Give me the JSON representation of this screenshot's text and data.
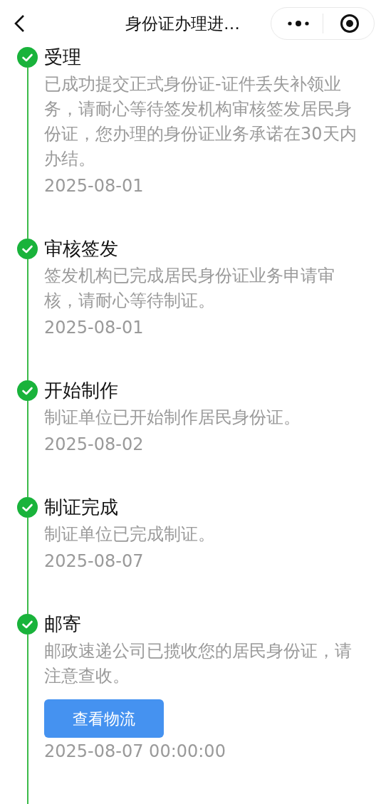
{
  "nav_bar": {
    "title": "身份证办理进…"
  },
  "steps": [
    {
      "title": "受理",
      "done": true,
      "description": "已成功提交正式身份证-证件丢失补领业务，请耐心等待签发机构审核签发居民身份证，您办理的身份证业务承诺在30天内办结。",
      "date": "2025-08-01"
    },
    {
      "title": "审核签发",
      "done": true,
      "description": "签发机构已完成居民身份证业务申请审核，请耐心等待制证。",
      "date": "2025-08-01"
    },
    {
      "title": "开始制作",
      "done": true,
      "description": "制证单位已开始制作居民身份证。",
      "date": "2025-08-02"
    },
    {
      "title": "制证完成",
      "done": true,
      "description": "制证单位已完成制证。",
      "date": "2025-08-07"
    },
    {
      "title": "邮寄",
      "done": true,
      "description": "邮政速递公司已揽收您的居民身份证，请注意查收。",
      "button": "查看物流",
      "date": "2025-08-07 00:00:00"
    }
  ]
}
